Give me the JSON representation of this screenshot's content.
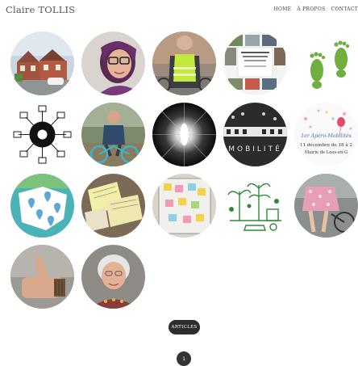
{
  "header": {
    "site_title": "Claire TOLLIS",
    "nav": [
      "HOME",
      "À PROPOS",
      "CONTACT"
    ]
  },
  "thumbnails": [
    {
      "id": "brick-houses-street",
      "text": ""
    },
    {
      "id": "woman-with-glasses",
      "text": ""
    },
    {
      "id": "safety-vest-bike",
      "text": ""
    },
    {
      "id": "event-poster-collage",
      "text": ""
    },
    {
      "id": "green-footprints",
      "text": ""
    },
    {
      "id": "mobility-icons-diagram",
      "text": ""
    },
    {
      "id": "man-on-bicycle",
      "text": ""
    },
    {
      "id": "light-burst",
      "text": ""
    },
    {
      "id": "mobilite-banner",
      "text": "MOBILITÉ"
    },
    {
      "id": "apero-mobilites",
      "text": "1er Apéro-Mobilités",
      "text2": "11 décembre de 18 à 2",
      "text3": "Mairie de Loos-en-G"
    },
    {
      "id": "map-pins",
      "text": ""
    },
    {
      "id": "papers-on-table",
      "text": ""
    },
    {
      "id": "sticky-notes-board",
      "text": ""
    },
    {
      "id": "green-city-drawing",
      "text": ""
    },
    {
      "id": "cyclist-floral-dress",
      "text": ""
    },
    {
      "id": "thumbs-up-hand",
      "text": ""
    },
    {
      "id": "elderly-woman-portrait",
      "text": ""
    }
  ],
  "articles_button": "ARTICLES",
  "pagination": {
    "current": "1"
  }
}
